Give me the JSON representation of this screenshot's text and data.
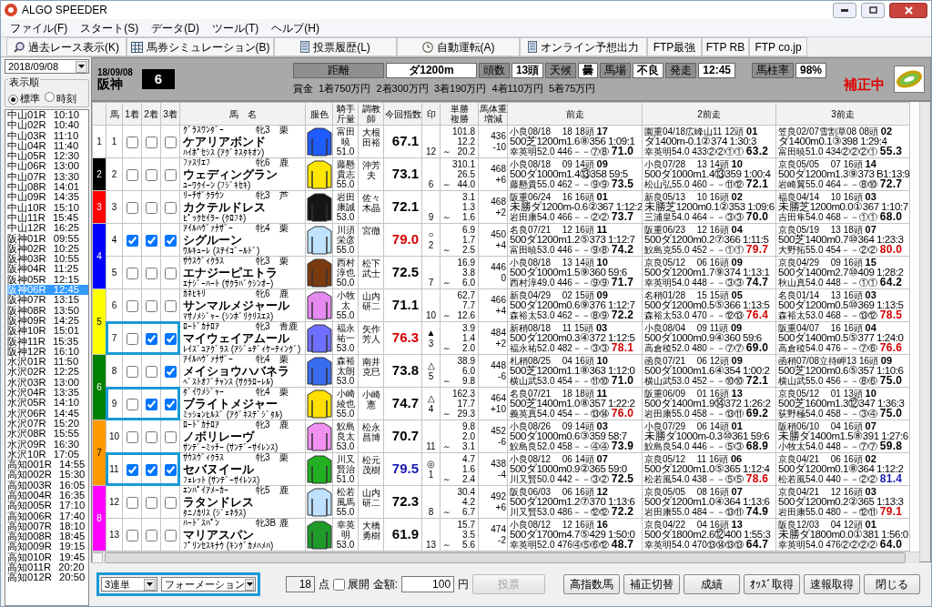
{
  "window": {
    "title": "ALGO SPEEDER"
  },
  "menu": [
    "ファイル(F)",
    "スタート(S)",
    "データ(D)",
    "ツール(T)",
    "ヘルプ(H)"
  ],
  "toolbar": [
    {
      "label": "過去レース表示(K)",
      "kind": "search"
    },
    {
      "label": "馬券シミュレーション(B)",
      "kind": "grid"
    },
    {
      "label": "投票履歴(L)",
      "kind": "doc"
    },
    {
      "label": "自動運転(A)",
      "kind": "clock"
    },
    {
      "label": "オンライン予想出力",
      "kind": "doc"
    },
    {
      "label": "FTP最強",
      "kind": "text"
    },
    {
      "label": "FTP RB",
      "kind": "text"
    },
    {
      "label": "FTP co.jp",
      "kind": "text"
    }
  ],
  "sidebar": {
    "date": "2018/09/08",
    "order_label": "表示順",
    "order_options": [
      {
        "label": "標準",
        "selected": true
      },
      {
        "label": "時刻",
        "selected": false
      }
    ],
    "races": [
      {
        "label": "中山01R",
        "time": "10:10",
        "selected": false
      },
      {
        "label": "中山02R",
        "time": "10:40",
        "selected": false
      },
      {
        "label": "中山03R",
        "time": "11:10",
        "selected": false
      },
      {
        "label": "中山04R",
        "time": "11:40",
        "selected": false
      },
      {
        "label": "中山05R",
        "time": "12:30",
        "selected": false
      },
      {
        "label": "中山06R",
        "time": "13:00",
        "selected": false
      },
      {
        "label": "中山07R",
        "time": "13:30",
        "selected": false
      },
      {
        "label": "中山08R",
        "time": "14:01",
        "selected": false
      },
      {
        "label": "中山09R",
        "time": "14:35",
        "selected": false
      },
      {
        "label": "中山10R",
        "time": "15:10",
        "selected": false
      },
      {
        "label": "中山11R",
        "time": "15:45",
        "selected": false
      },
      {
        "label": "中山12R",
        "time": "16:25",
        "selected": false
      },
      {
        "label": "阪神01R",
        "time": "09:55",
        "selected": false
      },
      {
        "label": "阪神02R",
        "time": "10:25",
        "selected": false
      },
      {
        "label": "阪神03R",
        "time": "10:55",
        "selected": false
      },
      {
        "label": "阪神04R",
        "time": "11:25",
        "selected": false
      },
      {
        "label": "阪神05R",
        "time": "12:15",
        "selected": false
      },
      {
        "label": "阪神06R",
        "time": "12:45",
        "selected": true
      },
      {
        "label": "阪神07R",
        "time": "13:15",
        "selected": false
      },
      {
        "label": "阪神08R",
        "time": "13:50",
        "selected": false
      },
      {
        "label": "阪神09R",
        "time": "14:25",
        "selected": false
      },
      {
        "label": "阪神10R",
        "time": "15:01",
        "selected": false
      },
      {
        "label": "阪神11R",
        "time": "15:35",
        "selected": false
      },
      {
        "label": "阪神12R",
        "time": "16:10",
        "selected": false
      },
      {
        "label": "水沢01R",
        "time": "11:50",
        "selected": false
      },
      {
        "label": "水沢02R",
        "time": "12:25",
        "selected": false
      },
      {
        "label": "水沢03R",
        "time": "13:00",
        "selected": false
      },
      {
        "label": "水沢04R",
        "time": "13:35",
        "selected": false
      },
      {
        "label": "水沢05R",
        "time": "14:10",
        "selected": false
      },
      {
        "label": "水沢06R",
        "time": "14:45",
        "selected": false
      },
      {
        "label": "水沢07R",
        "time": "15:20",
        "selected": false
      },
      {
        "label": "水沢08R",
        "time": "15:55",
        "selected": false
      },
      {
        "label": "水沢09R",
        "time": "16:30",
        "selected": false
      },
      {
        "label": "水沢10R",
        "time": "17:05",
        "selected": false
      },
      {
        "label": "高知001R",
        "time": "14:55",
        "selected": false
      },
      {
        "label": "高知002R",
        "time": "15:30",
        "selected": false
      },
      {
        "label": "高知003R",
        "time": "16:05",
        "selected": false
      },
      {
        "label": "高知004R",
        "time": "16:35",
        "selected": false
      },
      {
        "label": "高知005R",
        "time": "17:10",
        "selected": false
      },
      {
        "label": "高知006R",
        "time": "17:40",
        "selected": false
      },
      {
        "label": "高知007R",
        "time": "18:10",
        "selected": false
      },
      {
        "label": "高知008R",
        "time": "18:45",
        "selected": false
      },
      {
        "label": "高知009R",
        "time": "19:15",
        "selected": false
      },
      {
        "label": "高知010R",
        "time": "19:45",
        "selected": false
      },
      {
        "label": "高知011R",
        "time": "20:20",
        "selected": false
      },
      {
        "label": "高知012R",
        "time": "20:50",
        "selected": false
      }
    ]
  },
  "race": {
    "date": "18/09/08",
    "venue": "阪神",
    "number": "6",
    "fields": [
      {
        "label": "距離",
        "value": "ダ1200m"
      },
      {
        "label": "頭数",
        "value": "13頭"
      },
      {
        "label": "天候",
        "value": "曇"
      },
      {
        "label": "馬場",
        "value": "不良"
      },
      {
        "label": "発走",
        "value": "12:45"
      },
      {
        "label": "馬柱率",
        "value": "98%"
      }
    ],
    "prize_label": "賞金",
    "prizes": [
      "1着750万円",
      "2着300万円",
      "3着190万円",
      "4着110万円",
      "5着75万円"
    ],
    "status": "補正中"
  },
  "table": {
    "columns": [
      {
        "lines": [
          "馬"
        ]
      },
      {
        "lines": [
          "1着"
        ]
      },
      {
        "lines": [
          "2着"
        ]
      },
      {
        "lines": [
          "3着"
        ]
      },
      {
        "lines": [
          "馬　名"
        ]
      },
      {
        "lines": [
          "服色"
        ]
      },
      {
        "lines": [
          "騎手",
          "斤量"
        ]
      },
      {
        "lines": [
          "調教",
          "師"
        ]
      },
      {
        "lines": [
          "今回指数"
        ]
      },
      {
        "lines": [
          "印"
        ]
      },
      {
        "lines": [
          "単勝",
          "複勝"
        ]
      },
      {
        "lines": [
          "馬体重",
          "増減"
        ]
      },
      {
        "lines": [
          "前走"
        ]
      },
      {
        "lines": [
          "2前走"
        ]
      },
      {
        "lines": [
          "3前走"
        ]
      }
    ],
    "frames": [
      {
        "number": "1",
        "color": "#ffffff",
        "horses": [
          {
            "number": "1",
            "checks": [
              false,
              false,
              false
            ],
            "highlighted": false,
            "sire": "ｸﾞﾗｽﾜﾝﾀﾞｰ",
            "sex_age": "牝3",
            "coat": "栗",
            "name": "ケアリアボンド",
            "dam": "ﾊｲﾎﾟｾｼｽ (ｱｸﾞﾈｽﾀｷｵﾝ)",
            "silks": {
              "color": "#1f5cff"
            },
            "jockey": "富田暁",
            "weight": "51.0",
            "trainer": "大根田裕",
            "index": {
              "value": "67.1",
              "color": "#000000"
            },
            "popularity": "12",
            "odds": [
              "101.8",
              "12.2",
              "20.2"
            ],
            "sep": "～",
            "body_weight": "436",
            "weight_change": "-10",
            "races": [
              {
                "header": "小良08/18　 18 18頭",
                "finish": "17",
                "detail": "500芝1200m1.6⑧356 1:09:1",
                "rider": "幸英明52.0 446－－⑦⑧",
                "score": "71.0",
                "color": "#000000"
              },
              {
                "header": "園重04/18広峰山11 12頭",
                "finish": "01",
                "detail": "ダ1400m-0.1②374 1:30:3",
                "rider": "幸英明54.0 433②②①①",
                "score": "63.2",
                "color": "#000000"
              },
              {
                "header": "笠良02/07雪割草08 08頭",
                "finish": "02",
                "detail": "ダ1400m0.1③398 1:29:4",
                "rider": "富田暁51.0 434②②②①",
                "score": "55.3",
                "color": "#000000"
              }
            ]
          }
        ]
      },
      {
        "number": "2",
        "color": "#000000",
        "horses": [
          {
            "number": "2",
            "checks": [
              false,
              false,
              false
            ],
            "highlighted": false,
            "sire": "ﾌｧｽﾘｴﾌ",
            "sex_age": "牝6",
            "coat": "鹿",
            "name": "ウェディングラン",
            "dam": "ﾕｰﾜｸｲｰﾝ (ﾌｼﾞｷｾｷ)",
            "silks": {
              "color": "#ffe600"
            },
            "jockey": "藤懸貴志",
            "weight": "55.0",
            "trainer": "沖芳夫",
            "index": {
              "value": "73.1",
              "color": "#000000"
            },
            "popularity": "6",
            "odds": [
              "310.1",
              "26.5",
              "44.0"
            ],
            "sep": "～",
            "body_weight": "468",
            "weight_change": "+6",
            "races": [
              {
                "header": "小良08/18　 09 14頭",
                "finish": "09",
                "detail": "500ダ1000m1.4⑬358 59:5",
                "rider": "藤懸貴55.0 462－－⑨⑨",
                "score": "73.5",
                "color": "#000000"
              },
              {
                "header": "小良07/28　 13 14頭",
                "finish": "10",
                "detail": "500ダ1000m1.4⑬359 1:00:4",
                "rider": "松山弘55.0 460－－⑪⑫",
                "score": "72.1",
                "color": "#000000"
              },
              {
                "header": "京良05/05　 07 16頭",
                "finish": "14",
                "detail": "500ダ1200m1.3⑨373 B1:13:9",
                "rider": "岩崎翼55.0 464－－⑧⑩",
                "score": "72.7",
                "color": "#000000"
              }
            ]
          }
        ]
      },
      {
        "number": "3",
        "color": "#ff0000",
        "horses": [
          {
            "number": "3",
            "checks": [
              false,
              false,
              false
            ],
            "highlighted": false,
            "sire": "ﾘｰﾁｻﾞｸﾗｳﾝ",
            "sex_age": "牝3",
            "coat": "芦",
            "name": "カクテルドレス",
            "dam": "ﾋﾟｯｸｾｲﾗｰ (ｸﾛﾌﾈ)",
            "silks": {
              "color": "#151515"
            },
            "jockey": "岩田康誠",
            "weight": "53.0",
            "trainer": "佐々木晶",
            "index": {
              "value": "72.1",
              "color": "#000000"
            },
            "popularity": "9",
            "odds": [
              "3.1",
              "1.3",
              "1.6"
            ],
            "sep": "～",
            "body_weight": "468",
            "weight_change": "+2",
            "races": [
              {
                "header": "阪重06/24　 16 16頭",
                "finish": "01",
                "detail": "未勝ダ1200m-0.6②367 1:12:2",
                "rider": "岩田康54.0 466－－②②",
                "score": "73.7",
                "color": "#000000"
              },
              {
                "header": "新良05/13　 10 16頭",
                "finish": "02",
                "detail": "未勝芝1200m0.1②353 1:09:6",
                "rider": "三浦皇54.0 464－－③③",
                "score": "70.0",
                "color": "#000000"
              },
              {
                "header": "福良04/14　 10 16頭",
                "finish": "03",
                "detail": "未勝芝1200m0.0①367 1:10:7",
                "rider": "吉田隼54.0 468－－①①",
                "score": "68.0",
                "color": "#000000"
              }
            ]
          }
        ]
      },
      {
        "number": "4",
        "color": "#0000ff",
        "horses": [
          {
            "number": "4",
            "checks": [
              true,
              true,
              true
            ],
            "highlighted": false,
            "sire": "ｱｲﾙﾊｳﾞｧﾅｻﾞｰ",
            "sex_age": "牝4",
            "coat": "栗",
            "name": "シグルーン",
            "dam": "ﾜﾙｷｭｰﾚ (ｽﾃｲｺﾞｰﾙﾄﾞ)",
            "silks": {
              "color": "#bfe3ff"
            },
            "jockey": "川須栄彦",
            "weight": "55.0",
            "trainer": "宮徹",
            "index": {
              "value": "79.0",
              "color": "#d40000"
            },
            "mark": "○",
            "popularity": "2",
            "odds": [
              "6.9",
              "1.7",
              "2.5"
            ],
            "sep": "～",
            "body_weight": "450",
            "weight_change": "+4",
            "races": [
              {
                "header": "名良07/21　 12 16頭",
                "finish": "11",
                "detail": "500ダ1200m1.2⑤373 1:12:7",
                "rider": "富田暁53.0 446－－⑨⑧",
                "score": "74.2",
                "color": "#000000"
              },
              {
                "header": "阪重06/23　 12 16頭",
                "finish": "04",
                "detail": "500ダ1200m0.2⑦366 1:11:5",
                "rider": "鮫島克55.0 452－－①①",
                "score": "79.7",
                "color": "#d40000"
              },
              {
                "header": "京良05/19　 13 18頭",
                "finish": "07",
                "detail": "500芝1400m0.7⑩364 1:23:3",
                "rider": "大野拓55.0 454－－②②",
                "score": "80.0",
                "color": "#d40000"
              }
            ]
          },
          {
            "number": "5",
            "checks": [
              false,
              false,
              false
            ],
            "highlighted": false,
            "sire": "ｻｳｽｳﾞｨｸﾗｽ",
            "sex_age": "牝3",
            "coat": "栗",
            "name": "エナジーピエトラ",
            "dam": "ｴﾅｼﾞｰﾊｰﾄ (ｻｸﾗﾊﾞｸｼﾝｵｰ)",
            "silks": {
              "color": "#7a3a10"
            },
            "jockey": "西村淳也",
            "weight": "50.0",
            "trainer": "松下武士",
            "index": {
              "value": "72.5",
              "color": "#000000"
            },
            "popularity": "7",
            "odds": [
              "16.9",
              "3.8",
              "6.0"
            ],
            "sep": "～",
            "body_weight": "446",
            "weight_change": "0",
            "races": [
              {
                "header": "小良08/18　 13 14頭",
                "finish": "10",
                "detail": "500ダ1000m1.5⑨360 59:6",
                "rider": "西村淳49.0 446－－⑨⑨",
                "score": "71.7",
                "color": "#000000"
              },
              {
                "header": "京良05/12　 06 16頭",
                "finish": "09",
                "detail": "500ダ1200m1.7⑨374 1:13:1",
                "rider": "幸英明54.0 448－－③③",
                "score": "74.7",
                "color": "#000000"
              },
              {
                "header": "京良04/29　 09 16頭",
                "finish": "15",
                "detail": "500ダ1400m2.7⑩409 1:28:2",
                "rider": "秋山真54.0 448－－①①",
                "score": "64.2",
                "color": "#000000"
              }
            ]
          }
        ]
      },
      {
        "number": "5",
        "color": "#ffff00",
        "horses": [
          {
            "number": "6",
            "checks": [
              false,
              false,
              false
            ],
            "highlighted": false,
            "sire": "ｶﾈﾋｷﾘ",
            "sex_age": "牝6",
            "coat": "鹿",
            "name": "サンマルメジャール",
            "dam": "ﾏｻﾉﾒｼﾞｬｰ (ｼﾝﾎﾞﾘｸﾘｽｴｽ)",
            "silks": {
              "color": "#e48af0"
            },
            "jockey": "小牧太",
            "weight": "55.0",
            "trainer": "山内研二",
            "index": {
              "value": "71.1",
              "color": "#000000"
            },
            "popularity": "10",
            "odds": [
              "62.7",
              "7.7",
              "12.6"
            ],
            "sep": "～",
            "body_weight": "466",
            "weight_change": "+4",
            "races": [
              {
                "header": "新良04/29　 02 15頭",
                "finish": "09",
                "detail": "500ダ1200m0.6⑨376 1:12:7",
                "rider": "森裕太53.0 462－－⑧⑨",
                "score": "72.2",
                "color": "#000000"
              },
              {
                "header": "名稍01/28　 15 15頭",
                "finish": "05",
                "detail": "500ダ1200m0.5⑤366 1:13:5",
                "rider": "森裕太53.0 470－－⑫⑬",
                "score": "76.4",
                "color": "#d40000"
              },
              {
                "header": "名良01/14　 13 16頭",
                "finish": "03",
                "detail": "500ダ1200m0.5⑩369 1:13:5",
                "rider": "森裕太53.0 468－－⑬⑫",
                "score": "78.5",
                "color": "#d40000"
              }
            ]
          },
          {
            "number": "7",
            "checks": [
              false,
              true,
              true
            ],
            "highlighted": true,
            "sire": "ﾛｰﾄﾞｶﾅﾛｱ",
            "sex_age": "牝3",
            "coat": "青鹿",
            "name": "マイウェイアムール",
            "dam": "ﾚｲｽﾞﾕｱｸﾞﾗｽ (ｱｼﾞｭﾃﾞｨｹｰﾃｨﾝｸﾞ)",
            "silks": {
              "color": "#6e6eff"
            },
            "jockey": "福永祐一",
            "weight": "53.0",
            "trainer": "矢作芳人",
            "index": {
              "value": "76.3",
              "color": "#d40000"
            },
            "mark": "▲",
            "popularity": "3",
            "odds": [
              "3.9",
              "1.4",
              "2.0"
            ],
            "sep": "～",
            "body_weight": "484",
            "weight_change": "+2",
            "races": [
              {
                "header": "新稍08/18　 11 15頭",
                "finish": "03",
                "detail": "500ダ1200m0.3④372 1:12:5",
                "rider": "福永祐52.0 482－－③③",
                "score": "78.1",
                "color": "#d40000"
              },
              {
                "header": "小良08/04　 09 11頭",
                "finish": "09",
                "detail": "500ダ1000m0.9④360 59:6",
                "rider": "高倉稜52.0 480－－⑦⑦",
                "score": "69.0",
                "color": "#000000"
              },
              {
                "header": "阪重04/07　 16 16頭",
                "finish": "04",
                "detail": "500ダ1400m0.5⑤377 1:24:0",
                "rider": "高倉稜54.0 476－－⑦⑥",
                "score": "76.6",
                "color": "#d40000"
              }
            ]
          }
        ]
      },
      {
        "number": "6",
        "color": "#008000",
        "horses": [
          {
            "number": "8",
            "checks": [
              false,
              false,
              true
            ],
            "highlighted": false,
            "sire": "ｱｲﾙﾊｳﾞｧﾅｻﾞｰ",
            "sex_age": "牝4",
            "coat": "栗",
            "name": "メイショウハバネラ",
            "dam": "ﾍﾞｽﾄｵﾌﾞﾁｬﾝｽ (ｻｸﾗﾛｰﾚﾙ)",
            "silks": {
              "color": "#3a6cf0"
            },
            "jockey": "森裕太朗",
            "weight": "53.0",
            "trainer": "南井克巳",
            "index": {
              "value": "73.8",
              "color": "#000000"
            },
            "mark": "△",
            "popularity": "5",
            "odds": [
              "38.9",
              "6.0",
              "9.8"
            ],
            "sep": "～",
            "body_weight": "448",
            "weight_change": "-6",
            "races": [
              {
                "header": "札稍08/25　 04 16頭",
                "finish": "10",
                "detail": "500芝1200m1.1⑧363 1:12:0",
                "rider": "横山武53.0 454－－⑪⑩",
                "score": "71.0",
                "color": "#000000"
              },
              {
                "header": "函良07/21　 06 12頭",
                "finish": "09",
                "detail": "500ダ1000m1.6④354 1:00:2",
                "rider": "横山武53.0 452－－⑩⑩",
                "score": "72.1",
                "color": "#000000"
              },
              {
                "header": "函稍07/08立待岬13 16頭",
                "finish": "09",
                "detail": "500芝1200m0.6⑤357 1:10:6",
                "rider": "横山武55.0 456－－⑧⑥",
                "score": "75.0",
                "color": "#000000"
              }
            ]
          },
          {
            "number": "9",
            "checks": [
              false,
              true,
              true
            ],
            "highlighted": true,
            "sire": "ﾀﾞｲﾜﾒｼﾞｬｰ",
            "sex_age": "牝4",
            "coat": "栗",
            "name": "ブライトメジャー",
            "dam": "ﾐｯｼｮﾝﾋﾙｽﾞ (ｱｸﾞﾈｽﾃﾞｼﾞﾀﾙ)",
            "silks": {
              "color": "#ffe000"
            },
            "jockey": "小崎綾也",
            "weight": "55.0",
            "trainer": "小崎憲",
            "index": {
              "value": "74.7",
              "color": "#000000"
            },
            "mark": "△",
            "popularity": "4",
            "odds": [
              "162.3",
              "17.7",
              "29.3"
            ],
            "sep": "～",
            "body_weight": "464",
            "weight_change": "+10",
            "races": [
              {
                "header": "名良07/21　 18 18頭",
                "finish": "11",
                "detail": "500芝1400m1.0⑧357 1:22:2",
                "rider": "義英真54.0 454－－⑬⑭",
                "score": "76.0",
                "color": "#d40000"
              },
              {
                "header": "阪重06/09　 01 16頭",
                "finish": "13",
                "detail": "500ダ1400m1.9⑭372 1:26:2",
                "rider": "岩田康55.0 458－－⑬⑪",
                "score": "69.2",
                "color": "#000000"
              },
              {
                "header": "京良05/12　 01 13頭",
                "finish": "10",
                "detail": "500芝1600m1.3⑫347 1:36:3",
                "rider": "荻野極54.0 458－－③④",
                "score": "75.0",
                "color": "#000000"
              }
            ]
          }
        ]
      },
      {
        "number": "7",
        "color": "#ff9900",
        "horses": [
          {
            "number": "10",
            "checks": [
              false,
              false,
              false
            ],
            "highlighted": false,
            "sire": "ﾛｰﾄﾞｶﾅﾛｱ",
            "sex_age": "牝3",
            "coat": "鹿",
            "name": "ノボリレーヴ",
            "dam": "ｻﾝﾃﾞｰﾐｯﾁｰ (ｻﾝﾃﾞｰｻｲﾚﾝｽ)",
            "silks": {
              "color": "#f090f0"
            },
            "jockey": "鮫島良太",
            "weight": "53.0",
            "trainer": "松永昌博",
            "index": {
              "value": "70.7",
              "color": "#000000"
            },
            "popularity": "11",
            "odds": [
              "9.8",
              "2.0",
              "3.1"
            ],
            "sep": "～",
            "body_weight": "452",
            "weight_change": "-6",
            "races": [
              {
                "header": "小良08/26　 09 14頭",
                "finish": "03",
                "detail": "500ダ1000m0.6③359 58:7",
                "rider": "鮫島良52.0 458－－④④",
                "score": "73.9",
                "color": "#000000"
              },
              {
                "header": "小良07/29　 06 14頭",
                "finish": "01",
                "detail": "未勝ダ1000m-0.3⑩361 59:6",
                "rider": "鮫島良54.0 446－－⑤③",
                "score": "68.9",
                "color": "#000000"
              },
              {
                "header": "阪稍06/10　 04 16頭",
                "finish": "07",
                "detail": "未勝ダ1400m1.5⑧391 1:27:6",
                "rider": "小牧太54.0 448－－⑦⑦",
                "score": "59.8",
                "color": "#000000"
              }
            ]
          },
          {
            "number": "11",
            "checks": [
              true,
              true,
              true
            ],
            "highlighted": true,
            "sire": "ｻｳｽｳﾞｨｸﾗｽ",
            "sex_age": "牝3",
            "coat": "栗",
            "name": "セバヌイール",
            "dam": "ﾌｪﾚｯﾄ (ｻﾝﾃﾞｰｻｲﾚﾝｽ)",
            "silks": {
              "color": "#22b022"
            },
            "jockey": "川又賢治",
            "weight": "51.0",
            "trainer": "松元茂樹",
            "index": {
              "value": "79.5",
              "color": "#1a1ab4"
            },
            "mark": "◎",
            "popularity": "1",
            "odds": [
              "4.7",
              "1.6",
              "2.4"
            ],
            "sep": "～",
            "body_weight": "438",
            "weight_change": "-4",
            "races": [
              {
                "header": "小良08/12　 06 14頭",
                "finish": "07",
                "detail": "500ダ1000m0.9②365 59:0",
                "rider": "川又賢50.0 442－－③②",
                "score": "72.5",
                "color": "#000000"
              },
              {
                "header": "京良05/12　 11 16頭",
                "finish": "06",
                "detail": "500ダ1200m1.0⑤365 1:12:4",
                "rider": "松若風54.0 438－－⑤⑤",
                "score": "78.6",
                "color": "#d40000"
              },
              {
                "header": "京良04/21　 06 16頭",
                "finish": "02",
                "detail": "500ダ1200m0.1⑧364 1:12:2",
                "rider": "松若風54.0 440－－②②",
                "score": "81.4",
                "color": "#1a1ab4"
              }
            ]
          }
        ]
      },
      {
        "number": "8",
        "color": "#ff00ff",
        "horses": [
          {
            "number": "12",
            "checks": [
              false,
              false,
              false
            ],
            "highlighted": false,
            "sire": "ｴﾝﾊﾟｲｱﾒｰｶｰ",
            "sex_age": "牝5",
            "coat": "鹿",
            "name": "ラタンドレス",
            "dam": "ﾀﾆﾉｶﾘｽ (ｼﾞｪﾈﾗｽ)",
            "silks": {
              "color": "#c0e0ff"
            },
            "jockey": "松若風馬",
            "weight": "55.0",
            "trainer": "山内研二",
            "index": {
              "value": "72.3",
              "color": "#000000"
            },
            "popularity": "8",
            "odds": [
              "30.4",
              "4.2",
              "6.7"
            ],
            "sep": "～",
            "body_weight": "492",
            "weight_change": "+6",
            "races": [
              {
                "header": "阪良06/03　 06 16頭",
                "finish": "12",
                "detail": "500ダ1200m1.2⑦370 1:13:6",
                "rider": "川又賢53.0 486－－⑫⑫",
                "score": "72.2",
                "color": "#000000"
              },
              {
                "header": "京良05/05　 08 16頭",
                "finish": "07",
                "detail": "500ダ1200m1.0④364 1:13:6",
                "rider": "岩田康55.0 484－－⑬⑪",
                "score": "74.9",
                "color": "#000000"
              },
              {
                "header": "京良04/21　 12 16頭",
                "finish": "03",
                "detail": "500ダ1200m0.2②365 1:13:3",
                "rider": "岩田康55.0 480－－⑫⑪",
                "score": "79.1",
                "color": "#d40000"
              }
            ]
          },
          {
            "number": "13",
            "checks": [
              false,
              false,
              false
            ],
            "highlighted": false,
            "sire": "ﾊｰﾄﾞｽﾊﾟﾝ",
            "sex_age": "牝3B",
            "coat": "鹿",
            "name": "マリアスパン",
            "dam": "ﾌﾟﾘﾝｾｽｷﾅｳ (ｷﾝｸﾞｶﾒﾊﾒﾊ)",
            "silks": {
              "color": "#1f9a2a"
            },
            "jockey": "幸英明",
            "weight": "53.0",
            "trainer": "大橋勇樹",
            "index": {
              "value": "61.9",
              "color": "#000000"
            },
            "popularity": "13",
            "odds": [
              "15.7",
              "3.5",
              "5.6"
            ],
            "sep": "～",
            "body_weight": "474",
            "weight_change": "-2",
            "races": [
              {
                "header": "小良08/12　 12 16頭",
                "finish": "16",
                "detail": "500ダ1700m4.7⑤429 1:50:0",
                "rider": "幸英明52.0 476④⑤⑥⑫",
                "score": "48.7",
                "color": "#000000"
              },
              {
                "header": "京良04/22　 04 16頭",
                "finish": "13",
                "detail": "500ダ1800m2.6⑫400 1:55:3",
                "rider": "幸英明54.0 470⑬⑭⑬⑬",
                "score": "64.7",
                "color": "#000000"
              },
              {
                "header": "阪良12/03　 04 12頭",
                "finish": "01",
                "detail": "未勝ダ1800m0.0①381 1:56:0",
                "rider": "幸英明54.0 476②②②②",
                "score": "64.0",
                "color": "#000000"
              }
            ]
          }
        ]
      }
    ]
  },
  "bottom": {
    "bet_type": "3連単",
    "bet_method": "フォーメーション",
    "count": "18",
    "count_unit": "点",
    "expand": {
      "label": "展開",
      "checked": false
    },
    "amount_label": "金額:",
    "amount": "100",
    "amount_unit": "円",
    "buttons": [
      {
        "label": "投票",
        "disabled": true
      },
      {
        "label": "高指数馬",
        "disabled": false
      },
      {
        "label": "補正切替",
        "disabled": false
      },
      {
        "label": "成績",
        "disabled": false
      },
      {
        "label": "ｵｯｽﾞ取得",
        "disabled": false
      },
      {
        "label": "速報取得",
        "disabled": false
      },
      {
        "label": "閉じる",
        "disabled": false
      }
    ]
  }
}
